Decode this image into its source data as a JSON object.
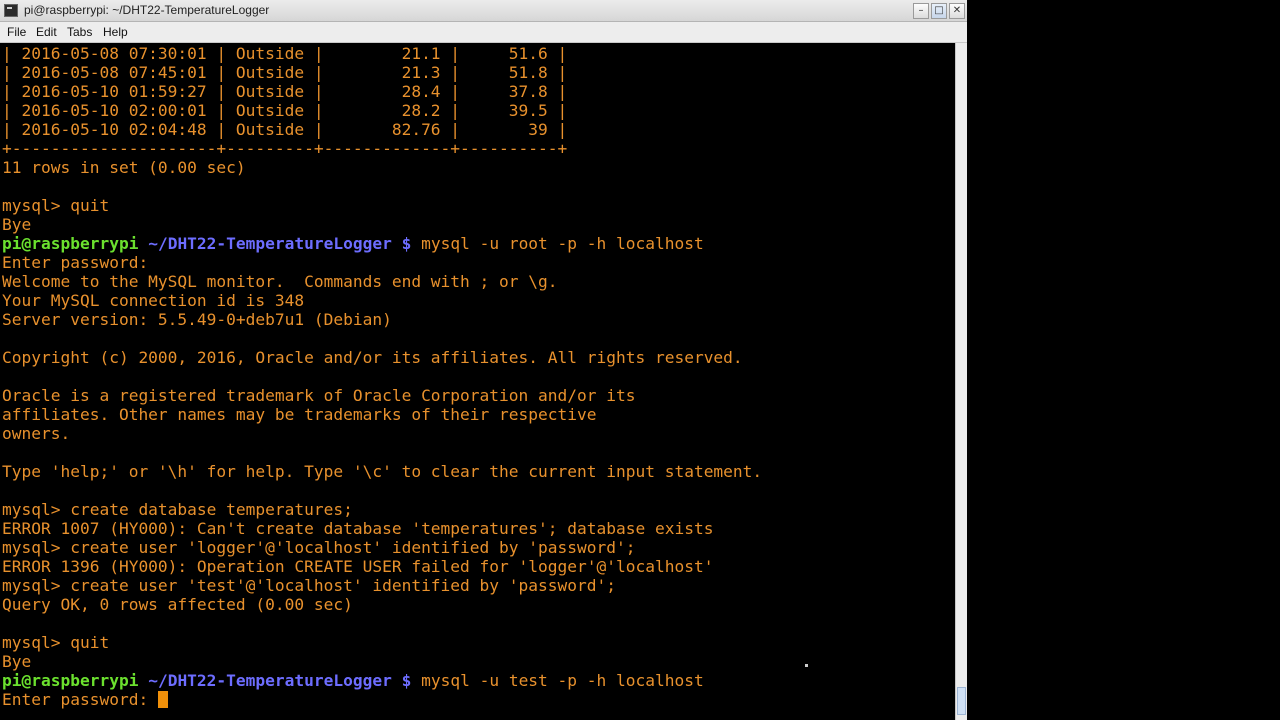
{
  "window": {
    "title": "pi@raspberrypi: ~/DHT22-TemperatureLogger"
  },
  "menu": {
    "file": "File",
    "edit": "Edit",
    "tabs": "Tabs",
    "help": "Help"
  },
  "terminal": {
    "lines": [
      "| 2016-05-08 07:30:01 | Outside |        21.1 |     51.6 |",
      "| 2016-05-08 07:45:01 | Outside |        21.3 |     51.8 |",
      "| 2016-05-10 01:59:27 | Outside |        28.4 |     37.8 |",
      "| 2016-05-10 02:00:01 | Outside |        28.2 |     39.5 |",
      "| 2016-05-10 02:04:48 | Outside |       82.76 |       39 |",
      "+---------------------+---------+-------------+----------+",
      "11 rows in set (0.00 sec)",
      "",
      "mysql> quit",
      "Bye",
      null,
      "Enter password:",
      "Welcome to the MySQL monitor.  Commands end with ; or \\g.",
      "Your MySQL connection id is 348",
      "Server version: 5.5.49-0+deb7u1 (Debian)",
      "",
      "Copyright (c) 2000, 2016, Oracle and/or its affiliates. All rights reserved.",
      "",
      "Oracle is a registered trademark of Oracle Corporation and/or its",
      "affiliates. Other names may be trademarks of their respective",
      "owners.",
      "",
      "Type 'help;' or '\\h' for help. Type '\\c' to clear the current input statement.",
      "",
      "mysql> create database temperatures;",
      "ERROR 1007 (HY000): Can't create database 'temperatures'; database exists",
      "mysql> create user 'logger'@'localhost' identified by 'password';",
      "ERROR 1396 (HY000): Operation CREATE USER failed for 'logger'@'localhost'",
      "mysql> create user 'test'@'localhost' identified by 'password';",
      "Query OK, 0 rows affected (0.00 sec)",
      "",
      "mysql> quit",
      "Bye"
    ],
    "prompt_user": "pi@raspberrypi",
    "prompt_path": "~/DHT22-TemperatureLogger",
    "prompt_symbol": "$",
    "command_1": "mysql -u root -p -h localhost",
    "command_2": "mysql -u test -p -h localhost",
    "final_prompt": "Enter password: "
  },
  "colors": {
    "output_text": "#e8912d",
    "prompt_user": "#6be02e",
    "prompt_path": "#6d6dff",
    "cursor": "#f0900a",
    "background": "#000000"
  }
}
